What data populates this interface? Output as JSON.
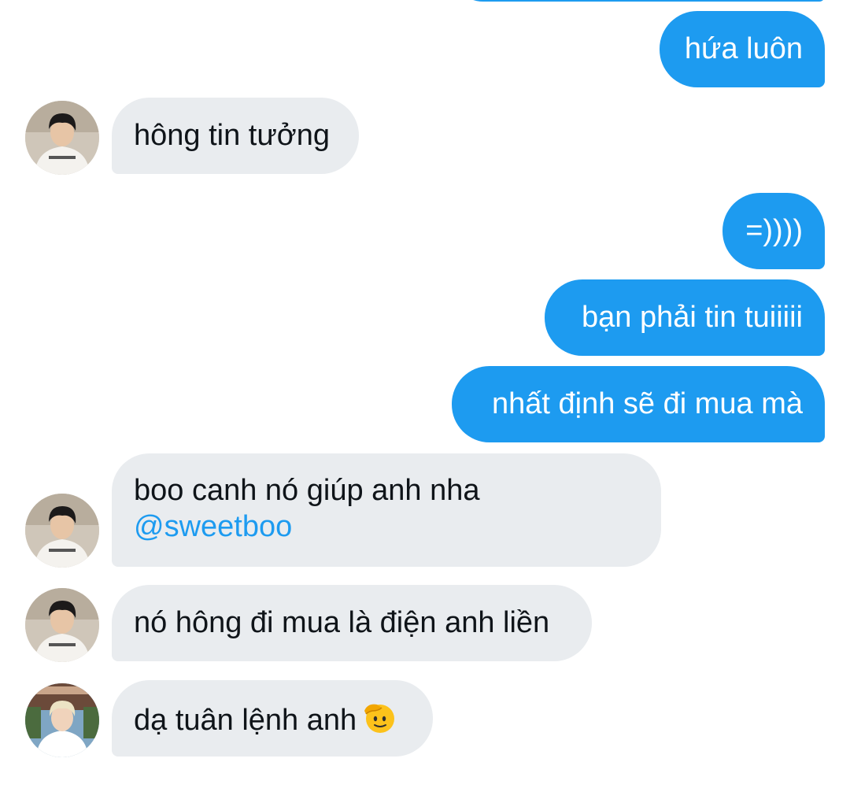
{
  "messages": [
    {
      "side": "sent",
      "text": "hứa luôn"
    },
    {
      "side": "received",
      "sender": "avatar-a",
      "text": "hông tin tưởng"
    },
    {
      "side": "sent",
      "text": "=))))"
    },
    {
      "side": "sent",
      "text": "bạn phải tin tuiiiii"
    },
    {
      "side": "sent",
      "text": "nhất định sẽ đi mua mà"
    },
    {
      "side": "received",
      "sender": "avatar-a",
      "text": "boo canh nó giúp anh nha",
      "mention": "@sweetboo"
    },
    {
      "side": "received",
      "sender": "avatar-a",
      "text": "nó hông đi mua là điện anh liền"
    },
    {
      "side": "received",
      "sender": "avatar-b",
      "text": "dạ tuân lệnh anh",
      "emoji": "saluting-face-emoji"
    }
  ],
  "colors": {
    "sent_bubble": "#1d9bf0",
    "received_bubble": "#e9ecef",
    "mention": "#1d9bf0"
  }
}
